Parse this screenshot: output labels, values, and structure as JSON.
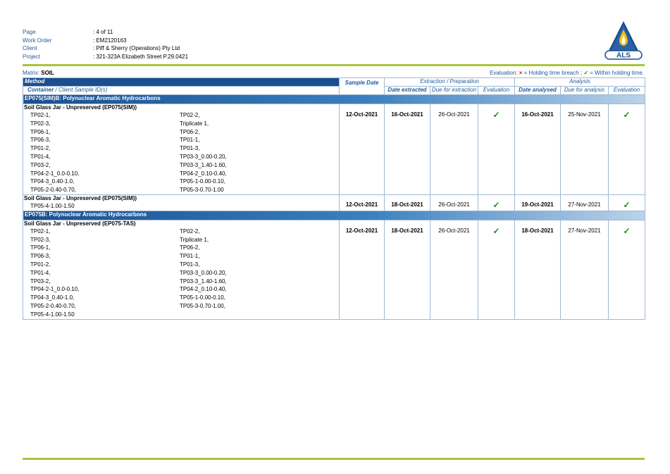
{
  "header": {
    "rows": [
      {
        "key": "Page",
        "value": ": 4 of 11"
      },
      {
        "key": "Work Order",
        "value": ": EM2120163"
      },
      {
        "key": "Client",
        "value": ": Piff & Sherry (Operations) Pty Ltd"
      },
      {
        "key": "Project",
        "value": ": 321-323A Elizabeth Street P.29.0421"
      }
    ],
    "logo_text": "ALS"
  },
  "matrix": {
    "label": "Matrix:",
    "value": "SOIL"
  },
  "evaluation_note": {
    "prefix": "Evaluation: ",
    "x": "×",
    "breach": " = Holding time breach ; ",
    "check": "✓",
    "within": " = Within holding time."
  },
  "table": {
    "head": {
      "method": "Method",
      "container": "Container",
      "client_sample": " / Client Sample ID(s)",
      "sample_date": "Sample Date",
      "extraction_group": "Extraction / Preparation",
      "analysis_group": "Analysis",
      "date_extracted": "Date extracted",
      "due_extraction": "Due for extraction",
      "evaluation": "Evaluation",
      "date_analysed": "Date analysed",
      "due_analysis": "Due for analysis",
      "evaluation2": "Evaluation"
    },
    "sections": [
      {
        "title": "EP075(SIM)B: Polynuclear Aromatic Hydrocarbons",
        "groups": [
          {
            "container": "Soil Glass Jar - Unpreserved (EP075(SIM))",
            "samples": [
              "TP02-1,",
              "TP02-2,",
              "TP02-3,",
              "Triplicate 1,",
              "TP06-1,",
              "TP06-2,",
              "TP06-3,",
              "TP01-1,",
              "TP01-2,",
              "TP01-3,",
              "TP01-4,",
              "TP03-3_0.00-0.20,",
              "TP03-2,",
              "TP03-3_1.40-1.60,",
              "TP04-2-1_0.0-0.10,",
              "TP04-2_0.10-0.40,",
              "TP04-3_0.40-1.0,",
              "TP05-1-0.00-0.10,",
              "TP05-2-0.40-0.70,",
              "TP05-3-0.70-1.00"
            ],
            "sample_date": "12-Oct-2021",
            "date_extracted": "16-Oct-2021",
            "due_extraction": "26-Oct-2021",
            "eval1": "✓",
            "date_analysed": "16-Oct-2021",
            "due_analysis": "25-Nov-2021",
            "eval2": "✓"
          },
          {
            "container": "Soil Glass Jar - Unpreserved (EP075(SIM))",
            "samples": [
              "TP05-4-1.00-1.50"
            ],
            "sample_date": "12-Oct-2021",
            "date_extracted": "18-Oct-2021",
            "due_extraction": "26-Oct-2021",
            "eval1": "✓",
            "date_analysed": "19-Oct-2021",
            "due_analysis": "27-Nov-2021",
            "eval2": "✓"
          }
        ]
      },
      {
        "title": "EP075B: Polynuclear Aromatic Hydrocarbons",
        "groups": [
          {
            "container": "Soil Glass Jar - Unpreserved (EP075-TAS)",
            "samples": [
              "TP02-1,",
              "TP02-2,",
              "TP02-3,",
              "Triplicate 1,",
              "TP06-1,",
              "TP06-2,",
              "TP06-3,",
              "TP01-1,",
              "TP01-2,",
              "TP01-3,",
              "TP01-4,",
              "TP03-3_0.00-0.20,",
              "TP03-2,",
              "TP03-3_1.40-1.60,",
              "TP04-2-1_0.0-0.10,",
              "TP04-2_0.10-0.40,",
              "TP04-3_0.40-1.0,",
              "TP05-1-0.00-0.10,",
              "TP05-2-0.40-0.70,",
              "TP05-3-0.70-1.00,",
              "TP05-4-1.00-1.50"
            ],
            "sample_date": "12-Oct-2021",
            "date_extracted": "18-Oct-2021",
            "due_extraction": "26-Oct-2021",
            "eval1": "✓",
            "date_analysed": "18-Oct-2021",
            "due_analysis": "27-Nov-2021",
            "eval2": "✓"
          }
        ]
      }
    ]
  },
  "colors": {
    "brand_blue": "#1a4f8e",
    "rule_green": "#a8c43c",
    "check_green": "#1a8a1a",
    "breach_red": "#dd1111"
  }
}
